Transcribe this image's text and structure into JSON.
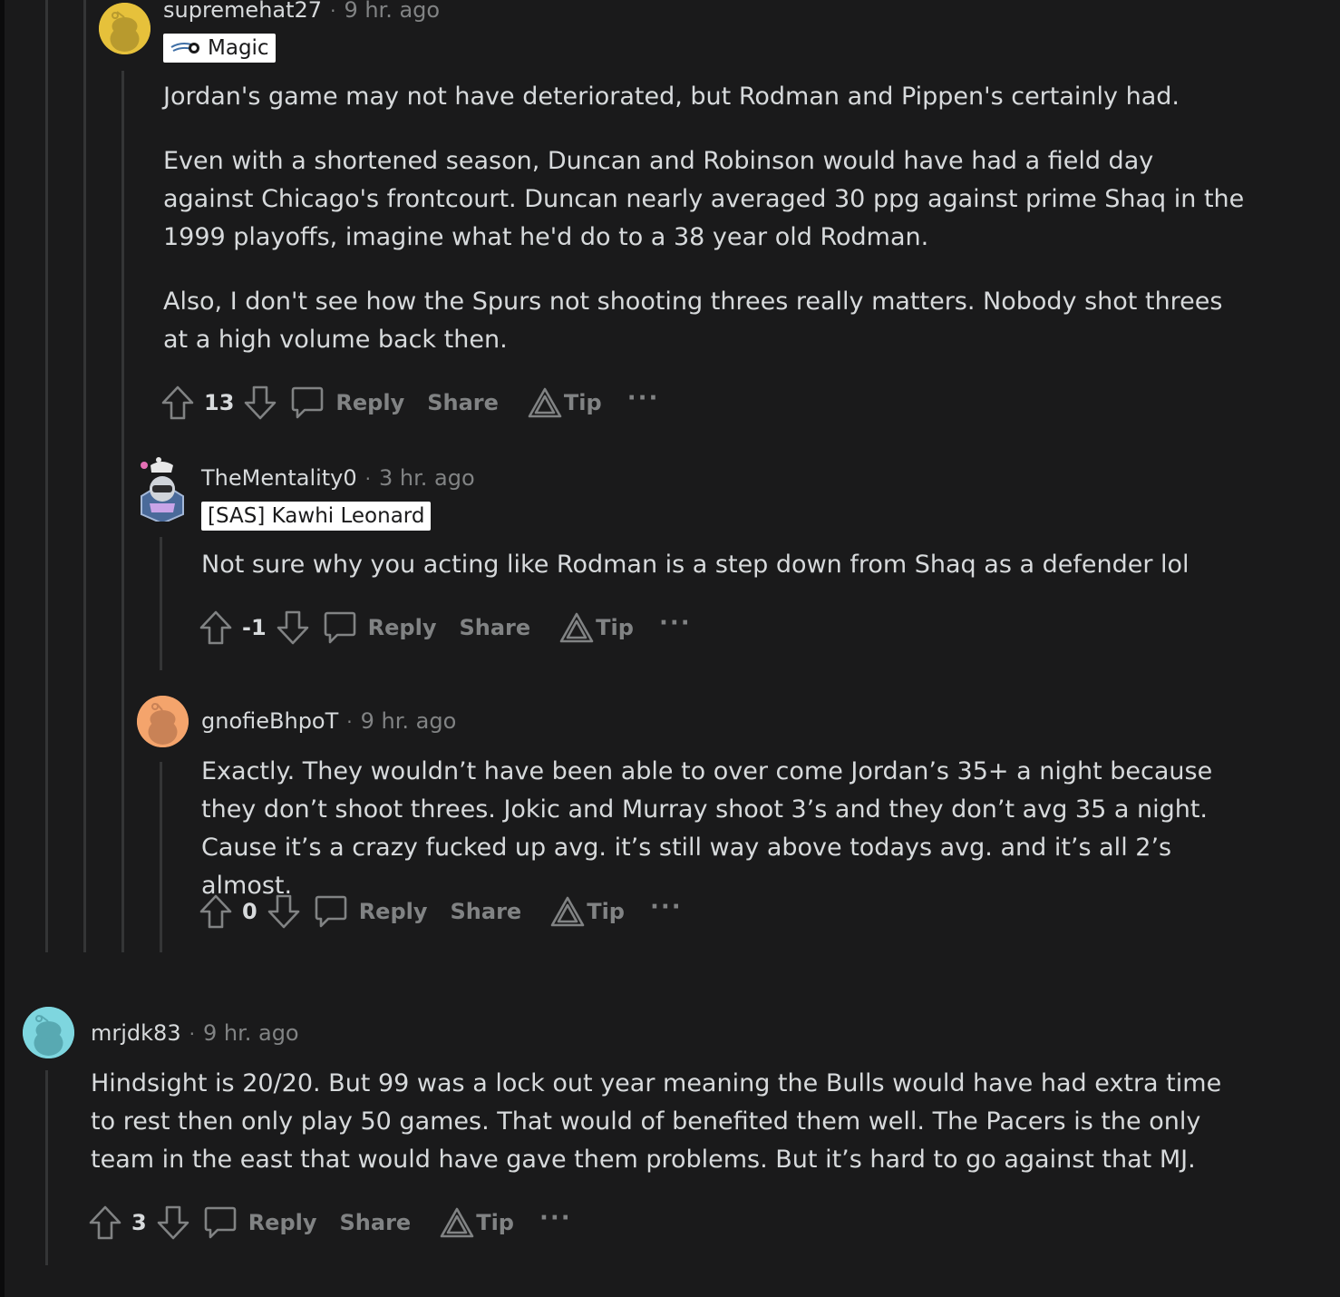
{
  "comments": [
    {
      "username": "supremehat27",
      "time": "9 hr. ago",
      "flair": "Magic",
      "avatar_color": "#e6c13b",
      "paragraphs": [
        "Jordan's game may not have deteriorated, but Rodman and Pippen's certainly had.",
        "Even with a shortened season, Duncan and Robinson would have had a field day against Chicago's frontcourt. Duncan nearly averaged 30 ppg against prime Shaq in the 1999 playoffs, imagine what he'd do to a 38 year old Rodman.",
        "Also, I don't see how the Spurs not shooting threes really matters. Nobody shot threes at a high volume back then."
      ],
      "score": "13"
    },
    {
      "username": "TheMentality0",
      "time": "3 hr. ago",
      "flair": "[SAS] Kawhi Leonard",
      "paragraphs": [
        "Not sure why you acting like Rodman is a step down from Shaq as a defender lol"
      ],
      "score": "-1"
    },
    {
      "username": "gnofieBhpoT",
      "time": "9 hr. ago",
      "avatar_color": "#f4a46c",
      "paragraphs": [
        "Exactly. They wouldn’t have been able to over come Jordan’s 35+ a night because they don’t shoot threes. Jokic and Murray shoot 3’s and they don’t avg 35 a night. Cause it’s a crazy fucked up avg. it’s still way above todays avg. and it’s all 2’s almost."
      ],
      "score": "0"
    },
    {
      "username": "mrjdk83",
      "time": "9 hr. ago",
      "avatar_color": "#7ed6df",
      "paragraphs": [
        "Hindsight is 20/20. But 99 was a lock out year meaning the Bulls would have had extra time to rest then only play 50 games. That would of benefited them well. The Pacers is the only team in the east that would have gave them problems. But it’s hard to go against that MJ."
      ],
      "score": "3"
    }
  ],
  "actions": {
    "reply": "Reply",
    "share": "Share",
    "tip": "Tip",
    "more": "···"
  },
  "separator": "·",
  "colors": {
    "background": "#1a1a1b",
    "thread_line": "#343536",
    "muted_text": "#818384",
    "body_text": "#d7dadc"
  }
}
